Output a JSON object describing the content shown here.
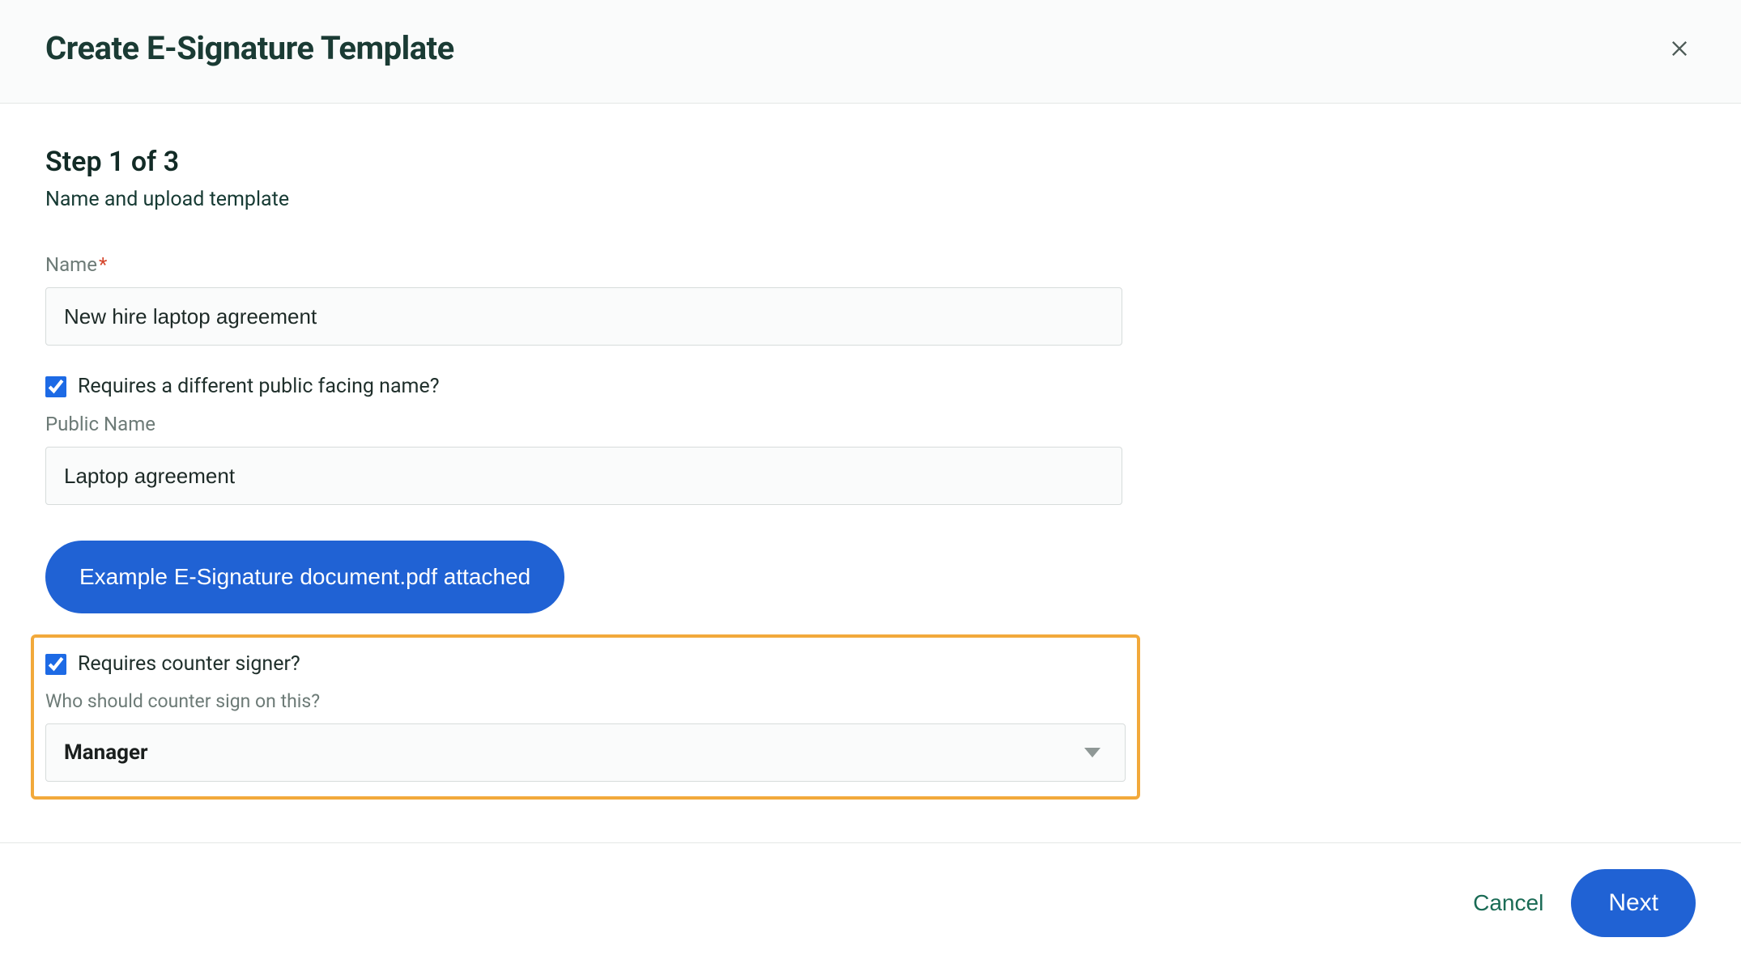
{
  "header": {
    "title": "Create E-Signature Template"
  },
  "step": {
    "heading": "Step 1 of 3",
    "subheading": "Name and upload template"
  },
  "form": {
    "name_label": "Name",
    "name_value": "New hire laptop agreement",
    "public_name_checkbox_label": "Requires a different public facing name?",
    "public_name_checked": true,
    "public_name_label": "Public Name",
    "public_name_value": "Laptop agreement",
    "attachment_button": "Example E-Signature document.pdf attached",
    "counter_signer_checkbox_label": "Requires counter signer?",
    "counter_signer_checked": true,
    "counter_signer_sub_label": "Who should counter sign on this?",
    "counter_signer_selected": "Manager"
  },
  "footer": {
    "cancel": "Cancel",
    "next": "Next"
  }
}
